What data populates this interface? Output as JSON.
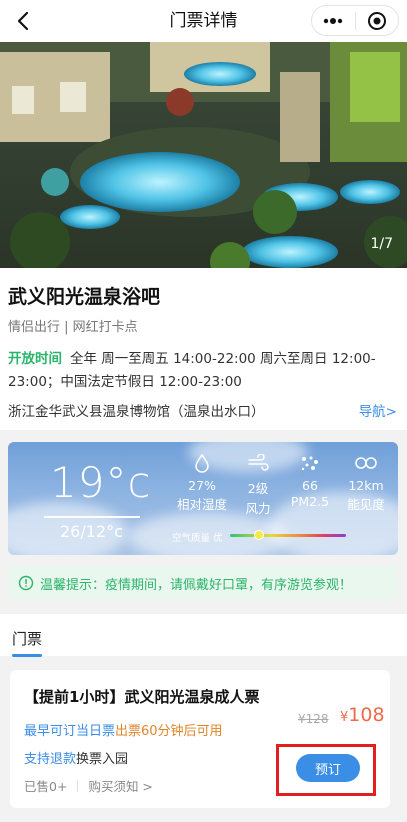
{
  "navbar": {
    "title": "门票详情",
    "back_icon": "chevron-left-icon",
    "more_icon": "more-dots-icon",
    "target_icon": "target-icon"
  },
  "hero": {
    "counter": "1/7"
  },
  "attraction": {
    "name": "武义阳光温泉浴吧",
    "tags": "情侣出行 | 网红打卡点",
    "hours_label": "开放时间",
    "hours_text": "全年 周一至周五 14:00-22:00 周六至周日 12:00-23:00；中国法定节假日 12:00-23:00",
    "address": "浙江金华武义县温泉博物馆（温泉出水口）",
    "nav_link": "导航>"
  },
  "weather": {
    "temperature": "19°c",
    "range": "26/12°c",
    "items": [
      {
        "icon": "humidity-drop-icon",
        "value": "27%",
        "label": "相对湿度"
      },
      {
        "icon": "wind-icon",
        "value": "2级",
        "label": "风力"
      },
      {
        "icon": "pm25-icon",
        "value": "66",
        "label": "PM2.5"
      },
      {
        "icon": "visibility-icon",
        "value": "12km",
        "label": "能见度"
      }
    ],
    "air_quality_label": "空气质量 优",
    "air_quality_level": 0.2
  },
  "tip": {
    "icon": "info-circle-icon",
    "text": "温馨提示：疫情期间，请佩戴好口罩，有序游览参观！"
  },
  "tickets": {
    "heading": "门票",
    "items": [
      {
        "name": "【提前1小时】武义阳光温泉成人票",
        "line1_blue": "最早可订当日票",
        "line1_orange": "出票60分钟后可用",
        "line2_blue": "支持退款",
        "line2_dark": "换票入园",
        "sold": "已售0+",
        "notice": "购买须知 >",
        "price_old": "¥128",
        "price_symbol": "¥",
        "price_new": "108",
        "book_label": "预订"
      }
    ]
  },
  "colors": {
    "accent_blue": "#3a8ee6",
    "green": "#2bb46a",
    "price_orange": "#ef6a4a",
    "highlight_red": "#e01f1f"
  }
}
